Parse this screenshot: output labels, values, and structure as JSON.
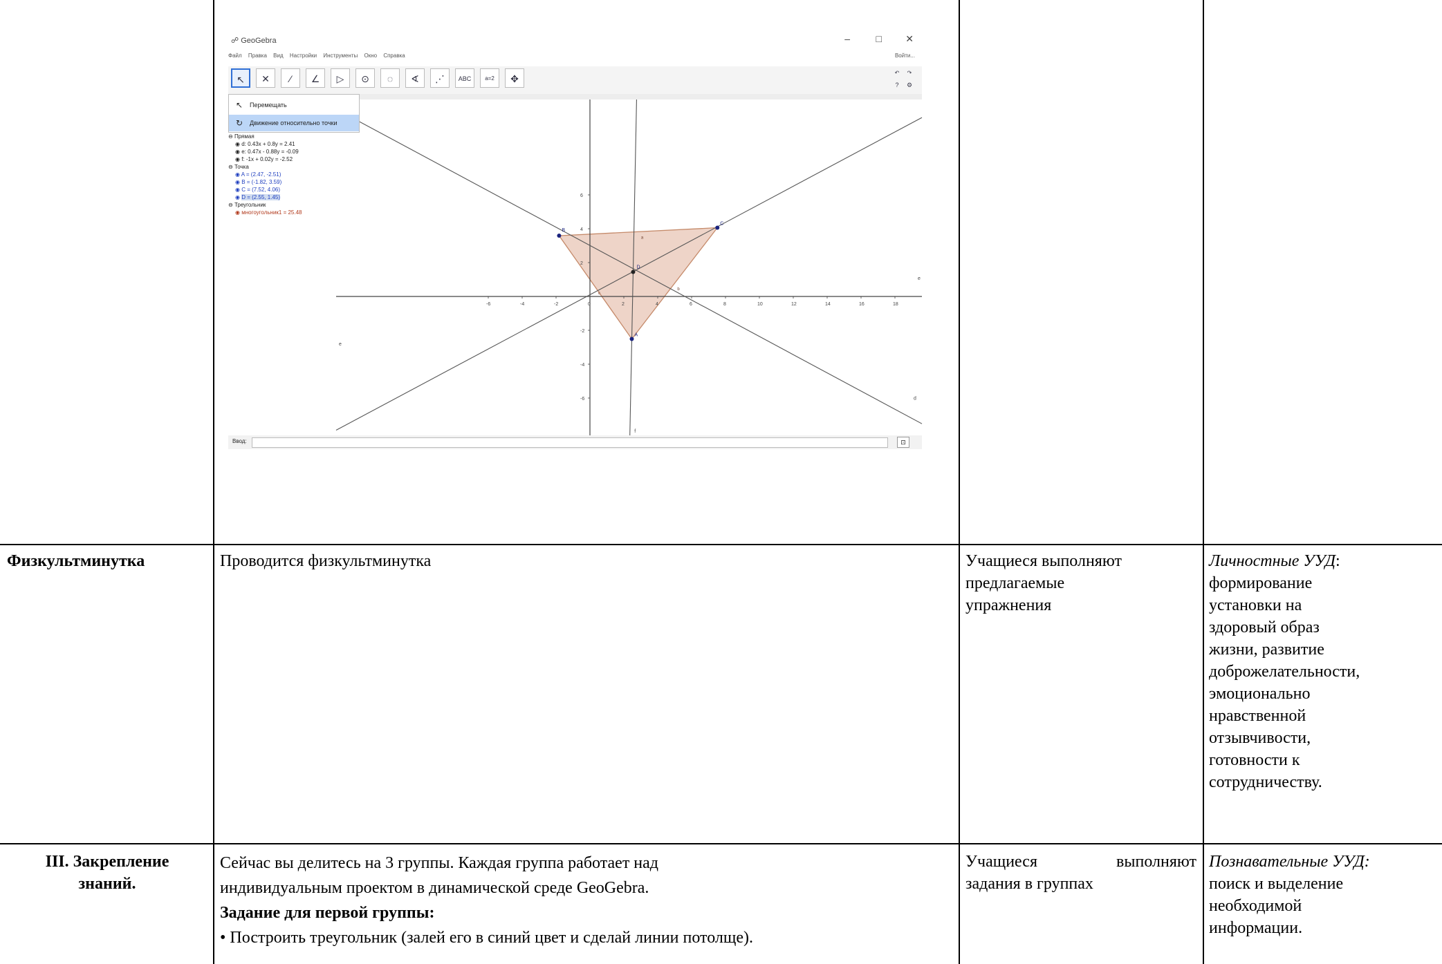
{
  "geogebra": {
    "window_title": "GeoGebra",
    "window_controls": {
      "minimize": "–",
      "maximize": "□",
      "close": "✕"
    },
    "menu": [
      "Файл",
      "Правка",
      "Вид",
      "Настройки",
      "Инструменты",
      "Окно",
      "Справка"
    ],
    "login_label": "Войти...",
    "tools": [
      "move-tool",
      "point-tool",
      "line-tool",
      "perpendicular-tool",
      "polygon-tool",
      "circle-tool",
      "circle-three-points-tool",
      "angle-tool",
      "reflect-tool",
      "text-tool",
      "slider-tool",
      "move-view-tool"
    ],
    "text_tool_label": "ABC",
    "slider_tool_label": "a=2",
    "submenu": [
      "Перемещать",
      "Движение относительно точки"
    ],
    "algebra": {
      "lines_header": "Прямая",
      "lines": [
        "d: 0.43x + 0.8y = 2.41",
        "e: 0.47x - 0.88y = -0.09",
        "f: -1x + 0.02y = -2.52"
      ],
      "points_header": "Точка",
      "points": [
        "A = (2.47, -2.51)",
        "B = (-1.82, 3.59)",
        "C = (7.52, 4.06)",
        "D = (2.55, 1.45)"
      ],
      "triangles_header": "Треугольник",
      "triangle": "многоугольник1 = 25.48"
    },
    "axis_labels": {
      "x": [
        "-6",
        "-4",
        "-2",
        "0",
        "2",
        "4",
        "6",
        "8",
        "10",
        "12",
        "14",
        "16",
        "18"
      ],
      "y": [
        "6",
        "4",
        "2",
        "-2",
        "-4",
        "-6"
      ]
    },
    "point_labels": [
      "A",
      "B",
      "C",
      "D"
    ],
    "line_labels": [
      "d",
      "e",
      "f"
    ],
    "side_labels": [
      "a",
      "b",
      "c"
    ],
    "input_label": "Ввод:",
    "colors": {
      "triangle_fill": "#e8c6b6",
      "triangle_stroke": "#c58a6a",
      "point": "#1a237e",
      "line": "#555555",
      "highlight": "#bcd6f7",
      "point_text": "#1f3fbf",
      "triangle_text": "#b23b1e"
    }
  },
  "rows": [
    {
      "stage": "Физкультминутка",
      "teacher": [
        "Проводится физкультминутка"
      ],
      "students": [
        "Учащиеся выполняют",
        "предлагаемые",
        "упражнения"
      ],
      "uud_title": "Личностные УУД",
      "uud_lines": [
        "формирование",
        "установки на",
        "здоровый образ",
        "жизни, развитие",
        "доброжелательности,",
        "эмоционально",
        "нравственной",
        "отзывчивости,",
        "готовности к",
        "сотрудничеству."
      ]
    },
    {
      "stage": [
        "III. Закрепление",
        "знаний."
      ],
      "teacher": [
        "Сейчас вы делитесь на 3 группы. Каждая группа работает над",
        "индивидуальным проектом в динамической среде GeoGebra."
      ],
      "task_header": "Задание для первой группы:",
      "bullet": "• Построить треугольник (залей его в синий цвет и сделай линии потолще).",
      "students": [
        "Учащиеся выполняют",
        "задания в группах"
      ],
      "uud_title": "Познавательные УУД:",
      "uud_lines": [
        "поиск и выделение",
        "необходимой",
        "информации."
      ]
    }
  ]
}
